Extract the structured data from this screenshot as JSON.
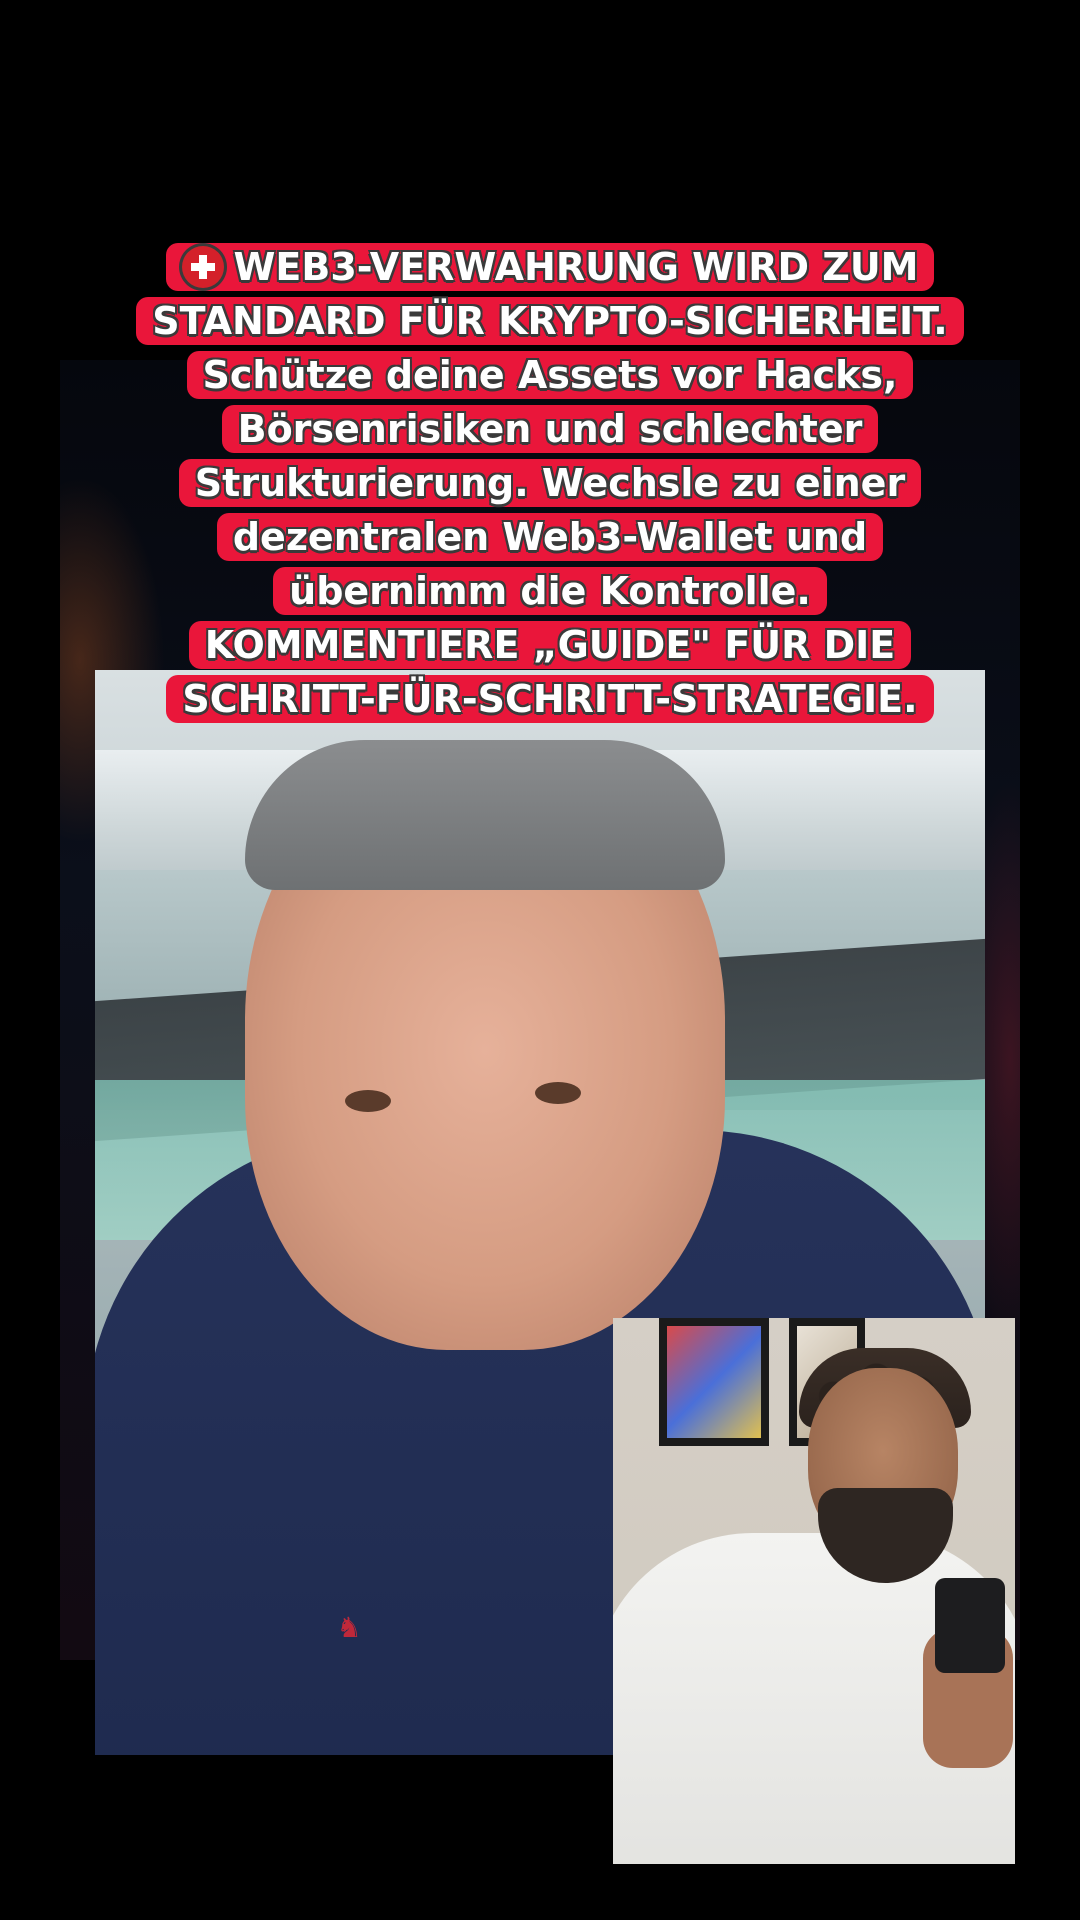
{
  "caption": {
    "lines": [
      "WEB3-VERWAHRUNG WIRD ZUM",
      "STANDARD FÜR KRYPTO-SICHERHEIT.",
      "Schütze deine Assets vor Hacks,",
      "Börsenrisiken und schlechter",
      "Strukturierung. Wechsle zu einer",
      "dezentralen Web3-Wallet und",
      "übernimm die Kontrolle.",
      "KOMMENTIERE „GUIDE\" FÜR DIE",
      "SCHRITT-FÜR-SCHRITT-STRATEGIE."
    ],
    "flag_icon": "swiss-flag-icon",
    "highlight_color": "#ea163a"
  },
  "main_video": {
    "label": ""
  },
  "pip_video": {
    "label": ""
  }
}
